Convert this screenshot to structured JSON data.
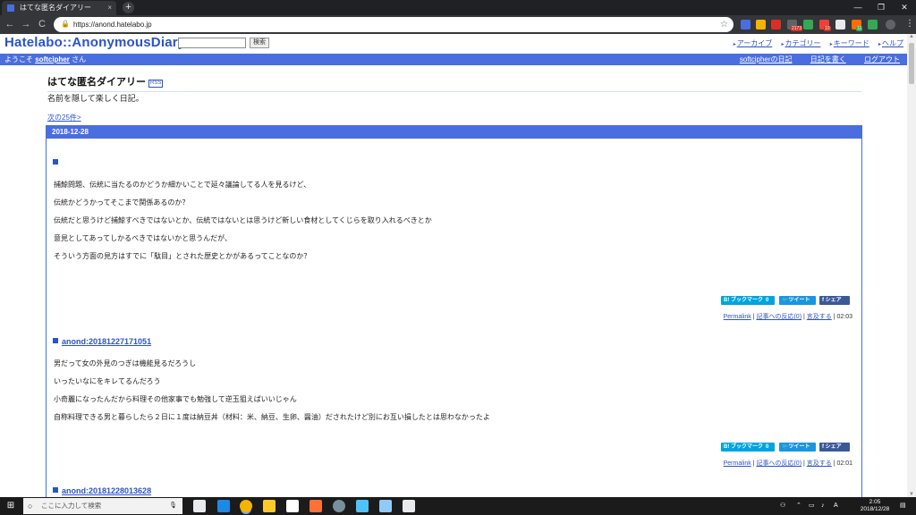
{
  "browser": {
    "tab_title": "はてな匿名ダイアリー",
    "tab_close": "×",
    "new_tab": "+",
    "url": "https://anond.hatelabo.jp",
    "back": "←",
    "forward": "→",
    "reload": "C",
    "bookmark_star": "☆",
    "menu": "⋮",
    "window_controls": [
      "—",
      "❐",
      "✕"
    ],
    "extension_badges": [
      "2173",
      "10",
      "11"
    ],
    "extension_colors": [
      "#4a6ee0",
      "#f4b400",
      "#d93025",
      "#5f6368",
      "#34a853",
      "#ea4335",
      "#e8eaed",
      "#ff6d00",
      "#34a853",
      "#5f6368"
    ]
  },
  "site": {
    "logo": "Hatelabo::AnonymousDiary",
    "search_value": "",
    "search_button": "検索",
    "top_links": [
      "アーカイブ",
      "カテゴリー",
      "キーワード",
      "ヘルプ"
    ],
    "welcome_prefix": "ようこそ",
    "username": "softcipher",
    "welcome_suffix": "さん",
    "user_links": [
      "softcipherの日記",
      "日記を書く",
      "ログアウト"
    ]
  },
  "main": {
    "title": "はてな匿名ダイアリー",
    "rss": "RSS",
    "tagline": "名前を隠して楽しく日記。",
    "next_link": "次の25件>",
    "day": "2018-12-28"
  },
  "entries": [
    {
      "heading": "",
      "paragraphs": [
        "捕鯨問題、伝統に当たるのかどうか細かいことで延々議論してる人を見るけど、",
        "伝統かどうかってそこまで関係あるのか？",
        "伝統だと思うけど捕鯨すべきではないとか、伝統ではないとは思うけど新しい食材としてくじらを取り入れるべきとか",
        "意見としてあってしかるべきではないかと思うんだが、",
        "そういう方面の見方はすでに「駄目」とされた歴史とかがあるってことなのか？"
      ],
      "share": {
        "hatena": "B! ブックマーク",
        "hatena_count": "0",
        "tweet": "ツイート",
        "facebook": "シェア"
      },
      "permalink": "Permalink",
      "reactions": "記事への反応(0)",
      "trackback": "言及する",
      "time": "02:03"
    },
    {
      "heading": "anond:20181227171051",
      "paragraphs": [
        "男だって女の外見のつぎは機能見るだろうし",
        "いったいなにをキレてるんだろう",
        "小奇麗になったんだから料理その他家事でも勉強して逆玉狙えばいいじゃん",
        "自称料理できる男と暮らしたら２日に１度は納豆丼（材料：米、納豆、生卵、醤油）だされたけど別にお互い損したとは思わなかったよ"
      ],
      "share": {
        "hatena": "B! ブックマーク",
        "hatena_count": "0",
        "tweet": "ツイート",
        "facebook": "シェア"
      },
      "permalink": "Permalink",
      "reactions": "記事への反応(0)",
      "trackback": "言及する",
      "time": "02:01"
    },
    {
      "heading": "anond:20181228013628"
    }
  ],
  "taskbar": {
    "search_placeholder": "ここに入力して検索",
    "clock_time": "2:05",
    "clock_date": "2018/12/28",
    "ime": "A",
    "app_colors": [
      "#e8eaed",
      "#1e88e5",
      "#f4b400",
      "#ffca28",
      "#ffffff",
      "#ff7139",
      "#78909c",
      "#4fc3f7",
      "#90caf9"
    ]
  }
}
